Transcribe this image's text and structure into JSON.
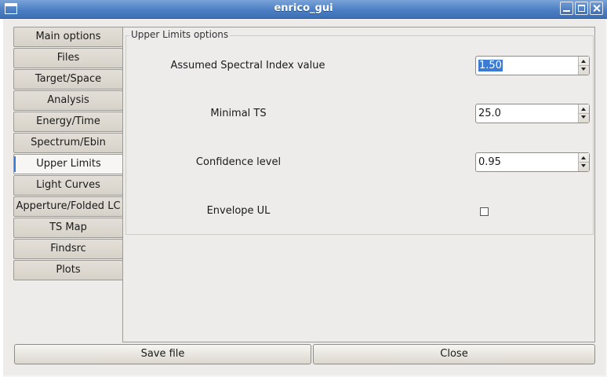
{
  "window": {
    "title": "enrico_gui"
  },
  "tabs": [
    {
      "label": "Main options"
    },
    {
      "label": "Files"
    },
    {
      "label": "Target/Space"
    },
    {
      "label": "Analysis"
    },
    {
      "label": "Energy/Time"
    },
    {
      "label": "Spectrum/Ebin"
    },
    {
      "label": "Upper Limits"
    },
    {
      "label": "Light Curves"
    },
    {
      "label": "Apperture/Folded LC"
    },
    {
      "label": "TS Map"
    },
    {
      "label": "Findsrc"
    },
    {
      "label": "Plots"
    }
  ],
  "active_tab": "Upper Limits",
  "upper_limits": {
    "group_title": "Upper Limits options",
    "spectral_index": {
      "label": "Assumed Spectral Index value",
      "value": "1.50"
    },
    "minimal_ts": {
      "label": "Minimal TS",
      "value": "25.0"
    },
    "confidence": {
      "label": "Confidence level",
      "value": "0.95"
    },
    "envelope": {
      "label": "Envelope UL",
      "checked": false
    }
  },
  "buttons": {
    "save": "Save file",
    "close": "Close"
  }
}
